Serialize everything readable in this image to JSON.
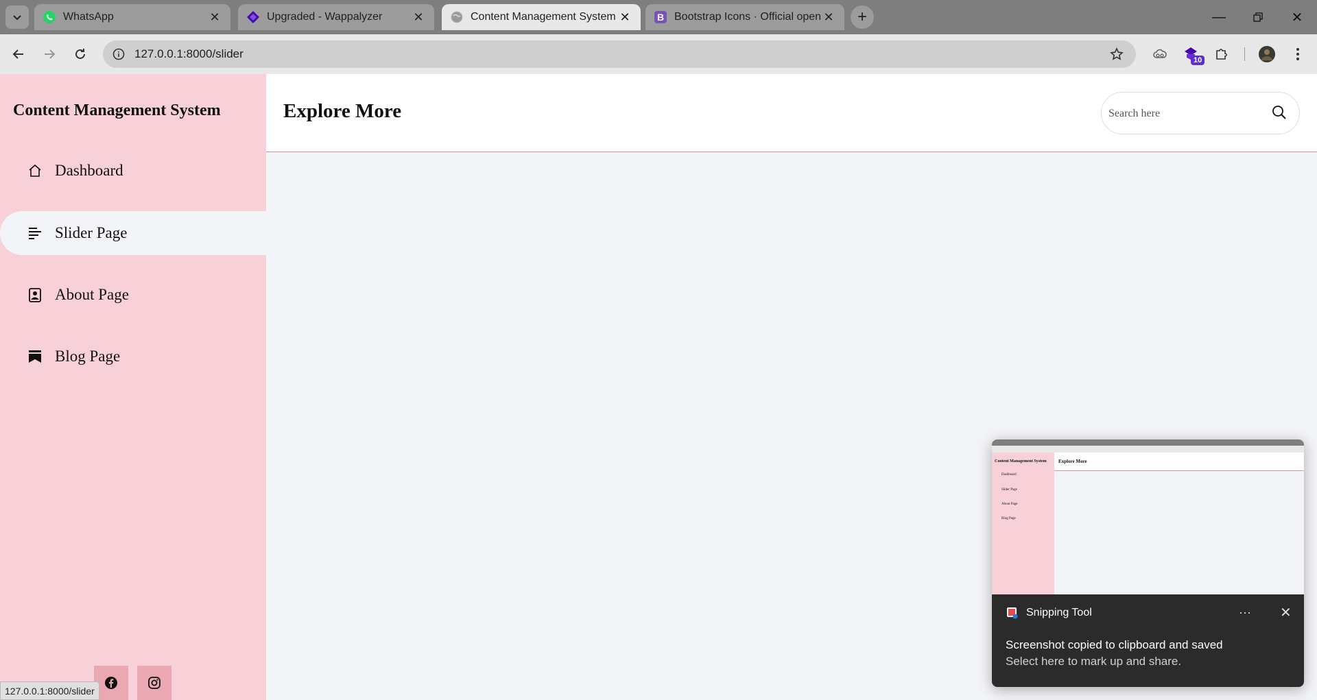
{
  "browser": {
    "tabs": [
      {
        "title": "WhatsApp",
        "icon": "whatsapp-icon",
        "active": false
      },
      {
        "title": "Upgraded - Wappalyzer",
        "icon": "wappalyzer-icon",
        "active": false
      },
      {
        "title": "Content Management System",
        "icon": "globe-icon",
        "active": true
      },
      {
        "title": "Bootstrap Icons · Official open s",
        "icon": "bootstrap-icon",
        "active": false
      }
    ],
    "url": "127.0.0.1:8000/slider",
    "extension_badge": "10"
  },
  "sidebar": {
    "brand": "Content Management System",
    "items": [
      {
        "label": "Dashboard",
        "icon": "house-icon",
        "active": false
      },
      {
        "label": "Slider Page",
        "icon": "text-left-icon",
        "active": true
      },
      {
        "label": "About Page",
        "icon": "person-square-icon",
        "active": false
      },
      {
        "label": "Blog Page",
        "icon": "bookmarks-icon",
        "active": false
      }
    ],
    "social": [
      {
        "icon": "facebook-icon"
      },
      {
        "icon": "instagram-icon"
      }
    ]
  },
  "header": {
    "title": "Explore More",
    "search_placeholder": "Search here"
  },
  "status_url": "127.0.0.1:8000/slider",
  "toast": {
    "app": "Snipping Tool",
    "message": "Screenshot copied to clipboard and saved",
    "sub": "Select here to mark up and share.",
    "thumb": {
      "brand": "Content Management System",
      "title": "Explore More",
      "items": [
        "Dashboard",
        "Slider Page",
        "About Page",
        "Blog Page"
      ]
    }
  },
  "colors": {
    "sidebar_bg": "#f8d0d8",
    "content_bg": "#f3f4f8",
    "social_bg": "#eaa8b3"
  }
}
